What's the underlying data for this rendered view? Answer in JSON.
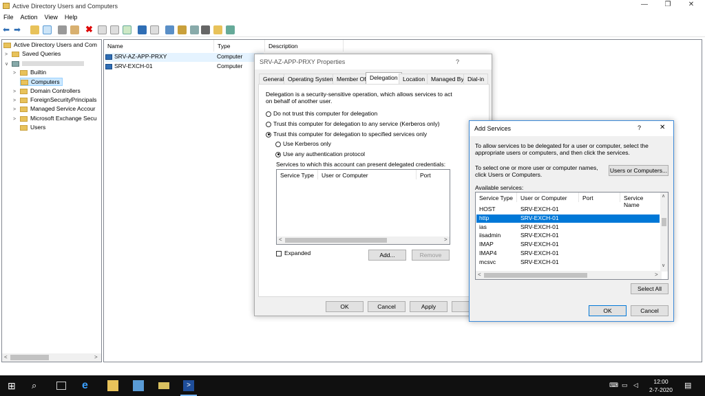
{
  "window": {
    "title": "Active Directory Users and Computers"
  },
  "menu": [
    "File",
    "Action",
    "View",
    "Help"
  ],
  "tree": {
    "root": "Active Directory Users and Com",
    "saved_queries": "Saved Queries",
    "domain": "",
    "children": [
      "Builtin",
      "Computers",
      "Domain Controllers",
      "ForeignSecurityPrincipals",
      "Managed Service Accour",
      "Microsoft Exchange Secu",
      "Users"
    ]
  },
  "list": {
    "columns": [
      "Name",
      "Type",
      "Description"
    ],
    "rows": [
      {
        "name": "SRV-AZ-APP-PRXY",
        "type": "Computer"
      },
      {
        "name": "SRV-EXCH-01",
        "type": "Computer"
      }
    ]
  },
  "properties": {
    "title": "SRV-AZ-APP-PRXY Properties",
    "help": "?",
    "tabs": [
      "General",
      "Operating System",
      "Member Of",
      "Delegation",
      "Location",
      "Managed By",
      "Dial-in"
    ],
    "intro": "Delegation is a security-sensitive operation, which allows services to act on behalf of another user.",
    "opt1": "Do not trust this computer for delegation",
    "opt2": "Trust this computer for delegation to any service (Kerberos only)",
    "opt3": "Trust this computer for delegation to specified services only",
    "sub1": "Use Kerberos only",
    "sub2": "Use any authentication protocol",
    "services_label": "Services to which this account can present delegated credentials:",
    "columns": [
      "Service Type",
      "User or Computer",
      "Port"
    ],
    "expanded": "Expanded",
    "add": "Add...",
    "remove": "Remove",
    "ok": "OK",
    "cancel": "Cancel",
    "apply": "Apply",
    "help_btn": "H"
  },
  "add_services": {
    "title": "Add Services",
    "help": "?",
    "close": "✕",
    "intro": "To allow services to be delegated for a user or computer, select the appropriate users or computers, and then click the services.",
    "select_text": "To select one or more user or computer names, click Users or Computers.",
    "users_button": "Users or Computers...",
    "available": "Available services:",
    "columns": [
      "Service Type",
      "User or Computer",
      "Port",
      "Service Name"
    ],
    "rows": [
      {
        "type": "HOST",
        "host": "SRV-EXCH-01"
      },
      {
        "type": "http",
        "host": "SRV-EXCH-01"
      },
      {
        "type": "ias",
        "host": "SRV-EXCH-01"
      },
      {
        "type": "iisadmin",
        "host": "SRV-EXCH-01"
      },
      {
        "type": "IMAP",
        "host": "SRV-EXCH-01"
      },
      {
        "type": "IMAP4",
        "host": "SRV-EXCH-01"
      },
      {
        "type": "mcsvc",
        "host": "SRV-EXCH-01"
      }
    ],
    "select_all": "Select All",
    "ok": "OK",
    "cancel": "Cancel"
  },
  "taskbar": {
    "time": "12:00",
    "date": "2-7-2020"
  },
  "colors": {
    "selection": "#0078d7",
    "taskbar": "#101010"
  }
}
